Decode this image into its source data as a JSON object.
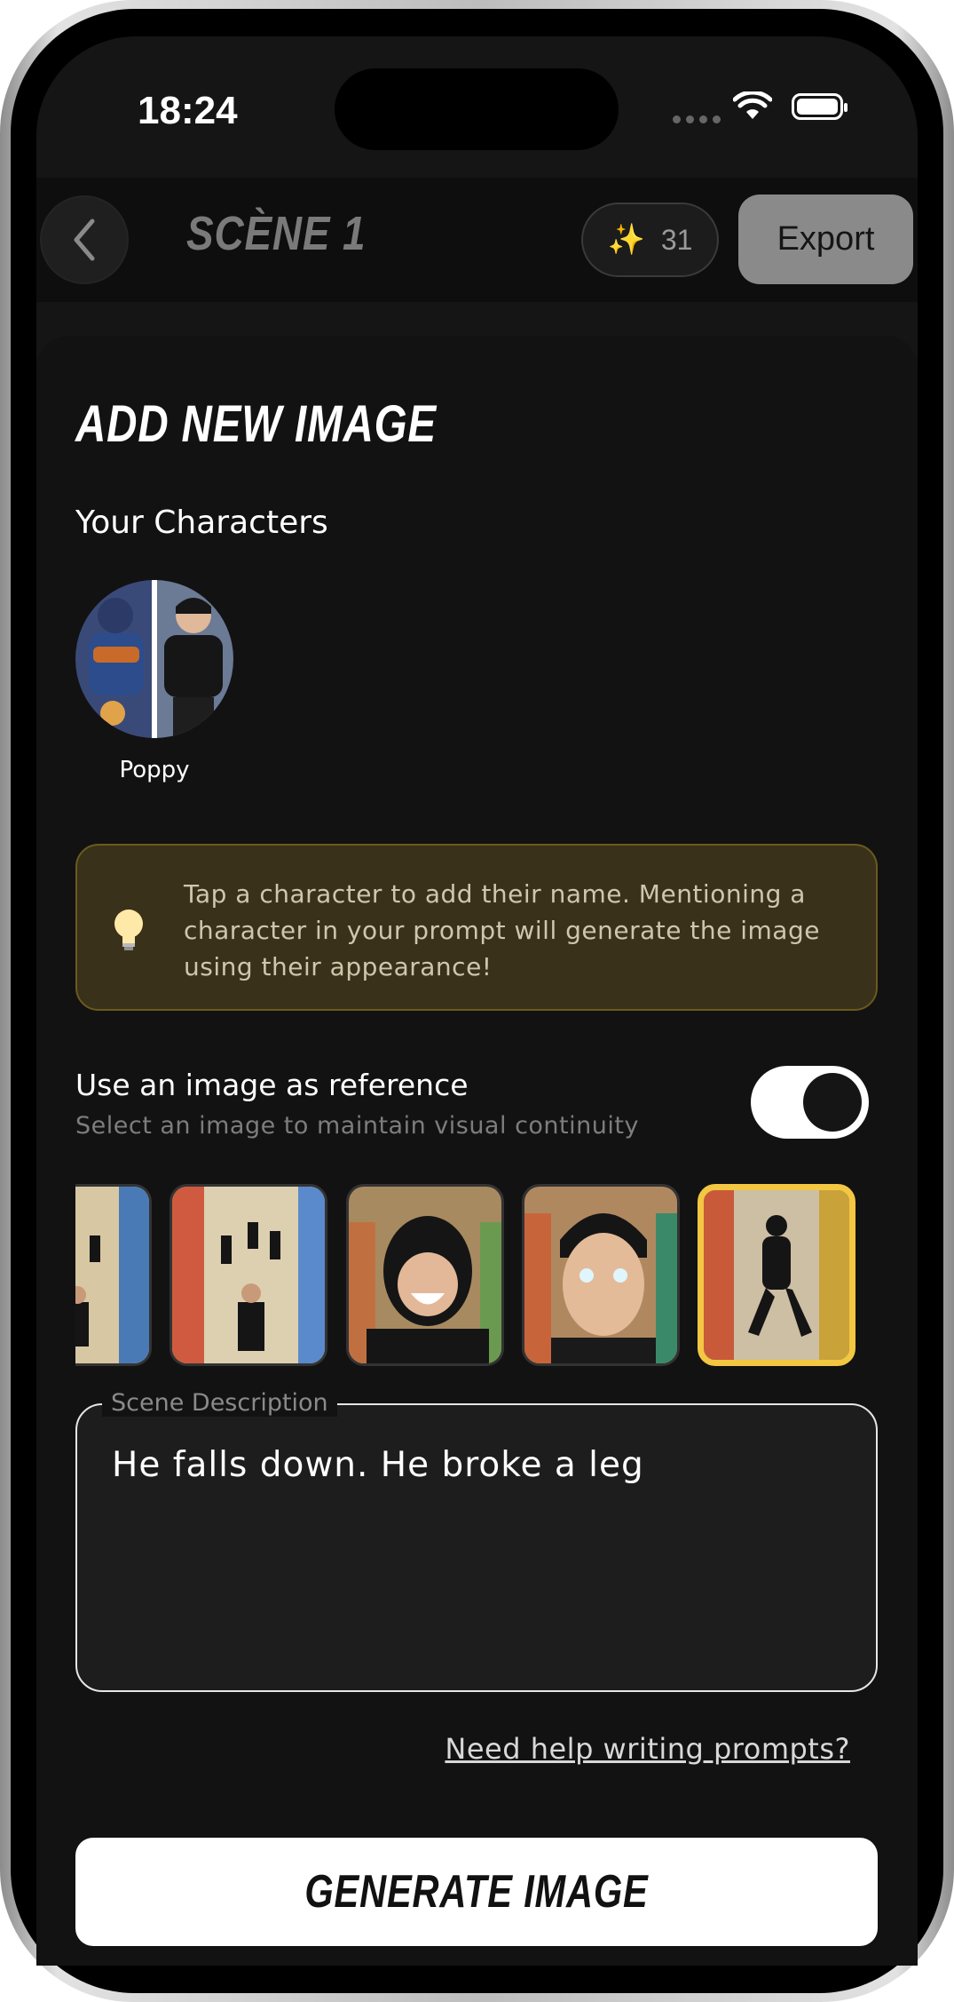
{
  "status_bar": {
    "time": "18:24"
  },
  "header": {
    "title": "SCÈNE 1",
    "credits": {
      "icon": "sparkles-icon",
      "count": "31"
    },
    "export_label": "Export"
  },
  "add_image": {
    "heading": "ADD NEW IMAGE",
    "characters_heading": "Your Characters",
    "characters": [
      {
        "name": "Poppy"
      }
    ],
    "tip": "Tap a character to add their name. Mentioning a character in your prompt will generate the image using their appearance!",
    "reference": {
      "title": "Use an image as reference",
      "subtitle": "Select an image to maintain visual continuity",
      "enabled": true,
      "selected_index": 4
    },
    "scene_description": {
      "legend": "Scene Description",
      "value": "He falls down. He broke a leg"
    },
    "help_link": "Need help writing prompts?",
    "generate_label": "GENERATE IMAGE"
  },
  "colors": {
    "accent_yellow": "#f3c741",
    "tip_background": "#3a311a",
    "tip_border": "#6a5a1e",
    "screen_background": "#151515"
  }
}
